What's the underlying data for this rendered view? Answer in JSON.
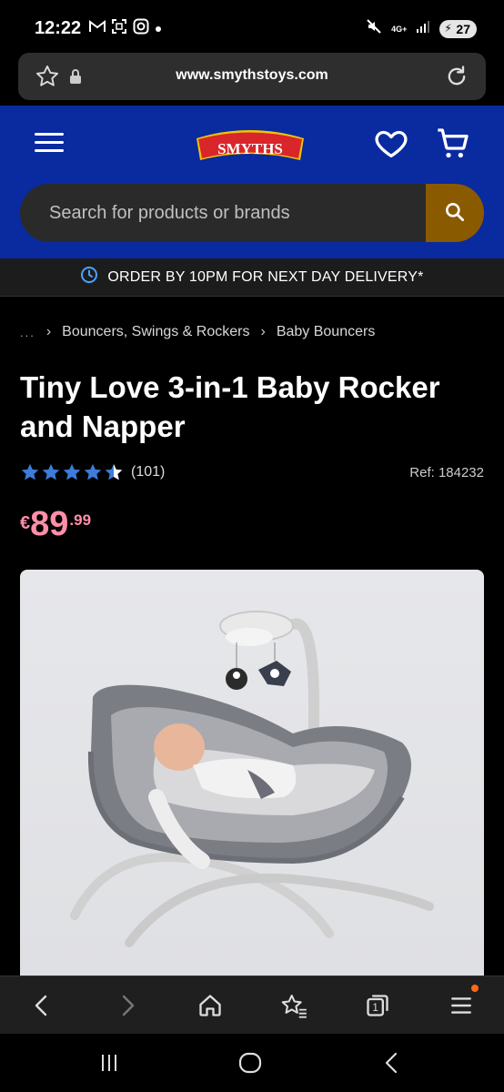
{
  "status_bar": {
    "time": "12:22",
    "left_icons": [
      "gmail-icon",
      "screenshot-icon",
      "instagram-icon",
      "dot-icon"
    ],
    "network": "4G+",
    "battery": "27"
  },
  "browser": {
    "url": "www.smythstoys.com"
  },
  "site_header": {
    "logo_text": "SMYTHS",
    "search_placeholder": "Search for products or brands"
  },
  "delivery_banner": {
    "text": "ORDER BY 10PM FOR NEXT DAY DELIVERY*"
  },
  "breadcrumb": {
    "ellipsis": "...",
    "items": [
      "Bouncers, Swings & Rockers",
      "Baby Bouncers"
    ]
  },
  "product": {
    "title": "Tiny Love 3-in-1 Baby Rocker and Napper",
    "rating_stars": 4.5,
    "rating_count": "(101)",
    "ref": "Ref: 184232",
    "price_currency": "€",
    "price_main": "89",
    "price_cents": ".99"
  },
  "colors": {
    "header_blue": "#0a2aa0",
    "search_button": "#8a5a00",
    "price_pink": "#ff8fa8",
    "star_blue": "#3b7dd8",
    "logo_red": "#d8262b"
  }
}
